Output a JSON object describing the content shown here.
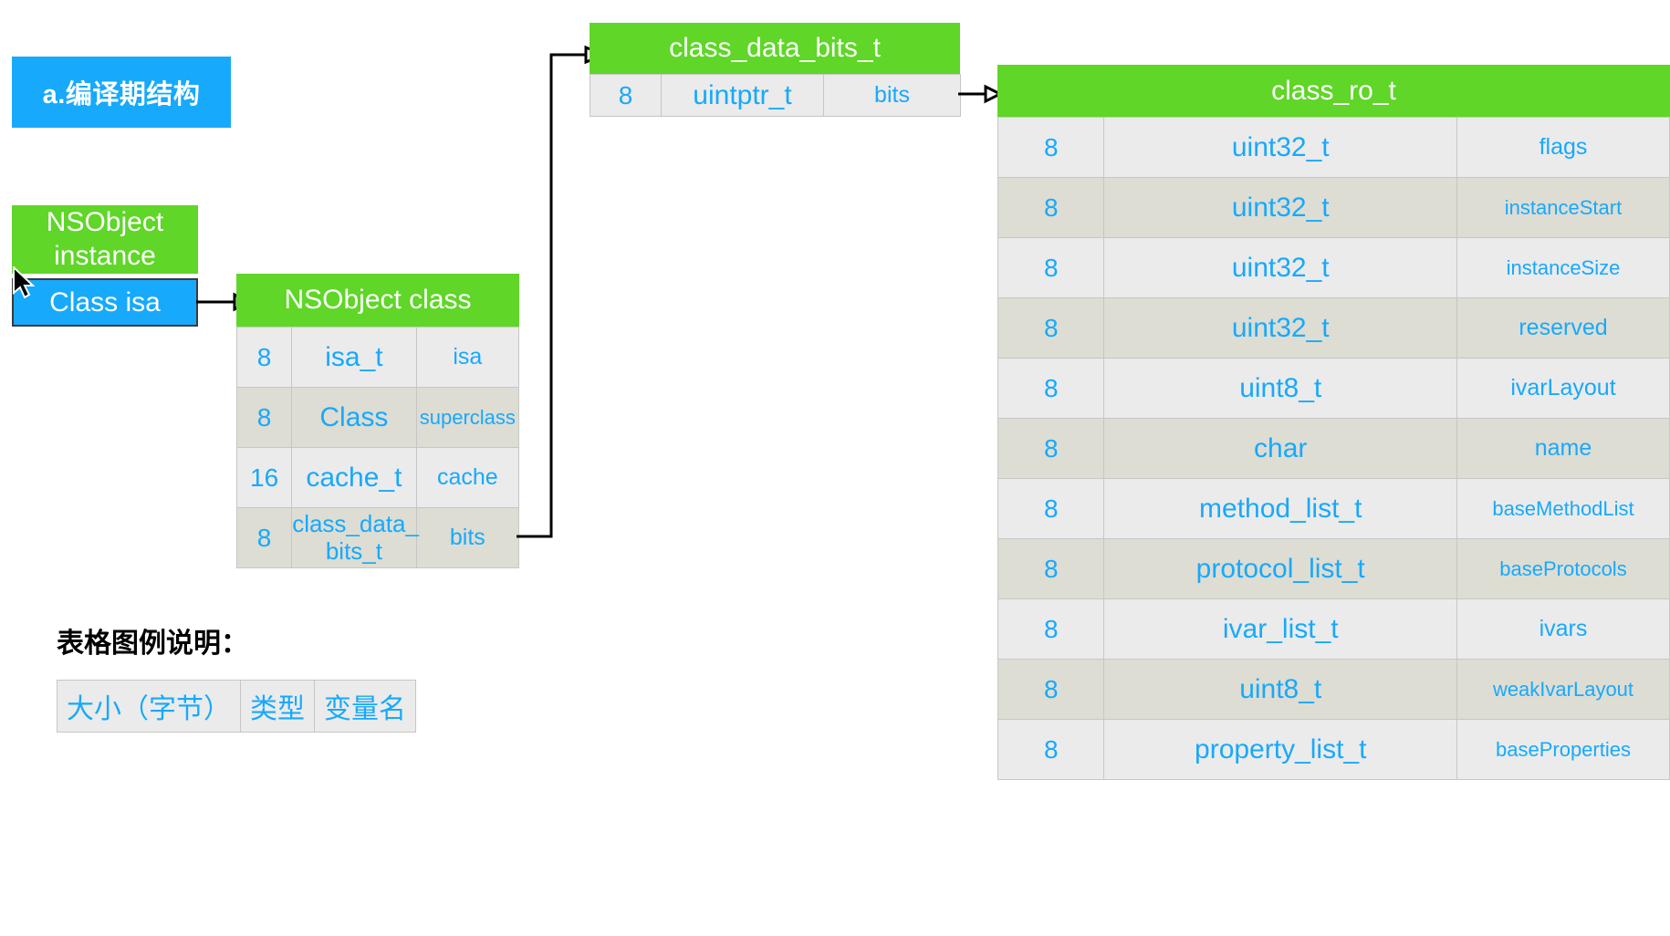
{
  "stage_badge": {
    "label": "a.编译期结构"
  },
  "instance": {
    "title_line1": "NSObject",
    "title_line2": "instance",
    "isa_label": "Class isa"
  },
  "structs": [
    {
      "id": "nsobject-class",
      "title": "NSObject class",
      "columns": [
        "大小（字节）",
        "类型",
        "变量名"
      ],
      "rows": [
        {
          "size": "8",
          "type": "isa_t",
          "name": "isa"
        },
        {
          "size": "8",
          "type": "Class",
          "name": "superclass"
        },
        {
          "size": "16",
          "type": "cache_t",
          "name": "cache"
        },
        {
          "size": "8",
          "type": "class_data_\nbits_t",
          "name": "bits"
        }
      ]
    },
    {
      "id": "class-data-bits-t",
      "title": "class_data_bits_t",
      "rows": [
        {
          "size": "8",
          "type": "uintptr_t",
          "name": "bits"
        }
      ]
    },
    {
      "id": "class-ro-t",
      "title": "class_ro_t",
      "rows": [
        {
          "size": "8",
          "type": "uint32_t",
          "name": "flags"
        },
        {
          "size": "8",
          "type": "uint32_t",
          "name": "instanceStart"
        },
        {
          "size": "8",
          "type": "uint32_t",
          "name": "instanceSize"
        },
        {
          "size": "8",
          "type": "uint32_t",
          "name": "reserved"
        },
        {
          "size": "8",
          "type": "uint8_t",
          "name": "ivarLayout"
        },
        {
          "size": "8",
          "type": "char",
          "name": "name"
        },
        {
          "size": "8",
          "type": "method_list_t",
          "name": "baseMethodList"
        },
        {
          "size": "8",
          "type": "protocol_list_t",
          "name": "baseProtocols"
        },
        {
          "size": "8",
          "type": "ivar_list_t",
          "name": "ivars"
        },
        {
          "size": "8",
          "type": "uint8_t",
          "name": "weakIvarLayout"
        },
        {
          "size": "8",
          "type": "property_list_t",
          "name": "baseProperties"
        }
      ]
    }
  ],
  "legend": {
    "title": "表格图例说明：",
    "cells": [
      "大小（字节）",
      "类型",
      "变量名"
    ]
  },
  "colors": {
    "accent_blue": "#17a9fc",
    "accent_green": "#5fd628",
    "row_light": "#ebebeb",
    "row_dark": "#ddddd4",
    "border": "#c6c6c6",
    "text_dark": "#000000"
  },
  "cursor": {
    "name": "arrow-pointer"
  }
}
